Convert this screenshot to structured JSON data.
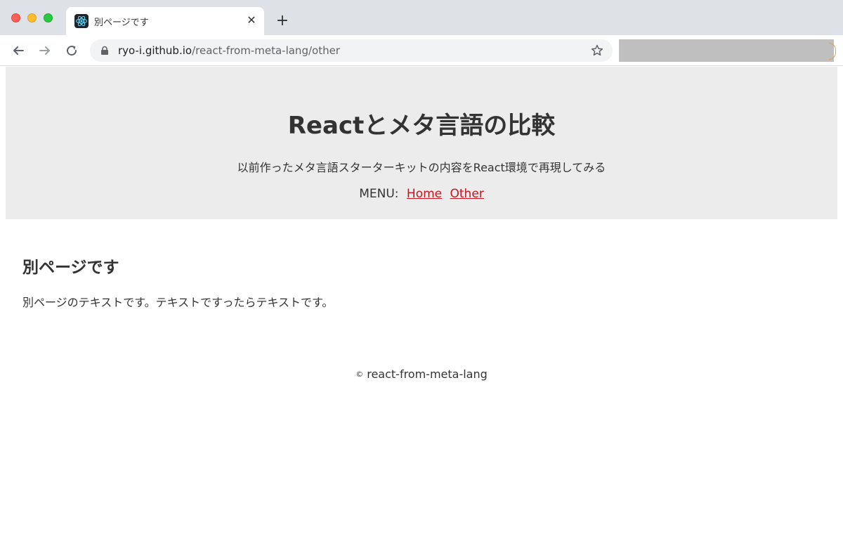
{
  "browser": {
    "tab_title": "別ページです",
    "tab_close": "✕",
    "new_tab": "+",
    "url_host": "ryo-i.github.io",
    "url_path": "/react-from-meta-lang/other",
    "icons": {
      "favicon": "react-logo-icon",
      "back": "arrow-left-icon",
      "forward": "arrow-right-icon",
      "reload": "reload-icon",
      "lock": "lock-icon",
      "bookmark": "star-icon"
    }
  },
  "header": {
    "title": "Reactとメタ言語の比較",
    "subtitle": "以前作ったメタ言語スターターキットの内容をReact環境で再現してみる",
    "menu_label": "MENU:",
    "menu_items": [
      {
        "label": "Home"
      },
      {
        "label": "Other"
      }
    ]
  },
  "main": {
    "heading": "別ページです",
    "body": "別ページのテキストです。テキストですったらテキストです。"
  },
  "footer": {
    "copyright_symbol": "©",
    "text": "react-from-meta-lang"
  },
  "colors": {
    "link": "#c8141e",
    "hero_bg": "#ececec",
    "text": "#333333"
  }
}
